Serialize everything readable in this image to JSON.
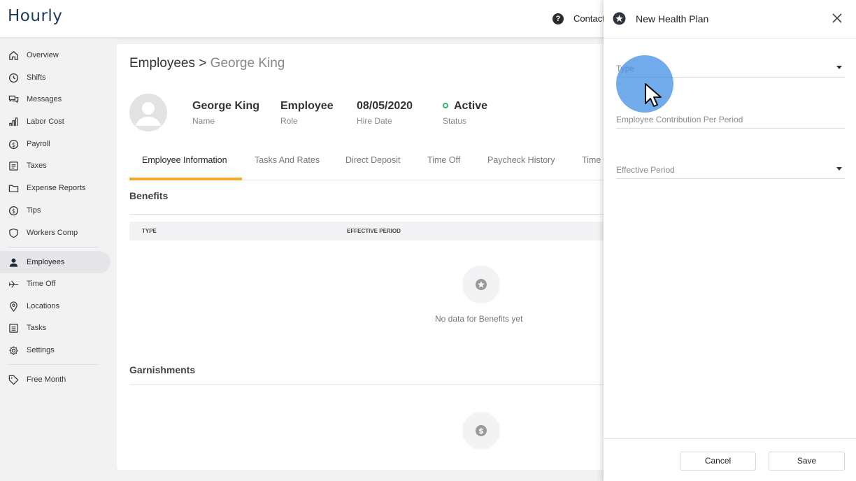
{
  "app": {
    "logo": "Hourly",
    "help_glyph": "?",
    "contact_label": "Contact"
  },
  "sidebar": {
    "items": [
      {
        "label": "Overview",
        "icon": "home-icon"
      },
      {
        "label": "Shifts",
        "icon": "clock-icon"
      },
      {
        "label": "Messages",
        "icon": "chat-icon"
      },
      {
        "label": "Labor Cost",
        "icon": "bar-chart-icon"
      },
      {
        "label": "Payroll",
        "icon": "dollar-circle-icon"
      },
      {
        "label": "Taxes",
        "icon": "document-icon"
      },
      {
        "label": "Expense Reports",
        "icon": "folder-icon"
      },
      {
        "label": "Tips",
        "icon": "coin-icon"
      },
      {
        "label": "Workers Comp",
        "icon": "shield-icon"
      },
      {
        "label": "Employees",
        "icon": "person-icon",
        "active": true
      },
      {
        "label": "Time Off",
        "icon": "plane-icon"
      },
      {
        "label": "Locations",
        "icon": "pin-icon"
      },
      {
        "label": "Tasks",
        "icon": "list-icon"
      },
      {
        "label": "Settings",
        "icon": "gear-icon"
      },
      {
        "label": "Free Month",
        "icon": "tag-icon"
      }
    ]
  },
  "main": {
    "breadcrumb_root": "Employees",
    "breadcrumb_sep": ">",
    "breadcrumb_current": "George King",
    "employee": {
      "name": "George King",
      "name_label": "Name",
      "role": "Employee",
      "role_label": "Role",
      "hire_date": "08/05/2020",
      "hire_date_label": "Hire Date",
      "status": "Active",
      "status_label": "Status",
      "status_color": "#2bb673"
    },
    "tabs": [
      "Employee Information",
      "Tasks And Rates",
      "Direct Deposit",
      "Time Off",
      "Paycheck History",
      "Time"
    ],
    "active_tab": "Employee Information",
    "accent_color": "#f0a830",
    "benefits": {
      "title": "Benefits",
      "columns": [
        "TYPE",
        "EFFECTIVE PERIOD"
      ],
      "empty_text": "No data for Benefits yet"
    },
    "garnishments": {
      "title": "Garnishments"
    }
  },
  "panel": {
    "title": "New Health Plan",
    "fields": [
      {
        "label": "Type",
        "type": "select"
      },
      {
        "label": "Employee Contribution Per Period",
        "type": "text"
      },
      {
        "label": "Effective Period",
        "type": "select"
      }
    ],
    "cancel_label": "Cancel",
    "save_label": "Save"
  }
}
